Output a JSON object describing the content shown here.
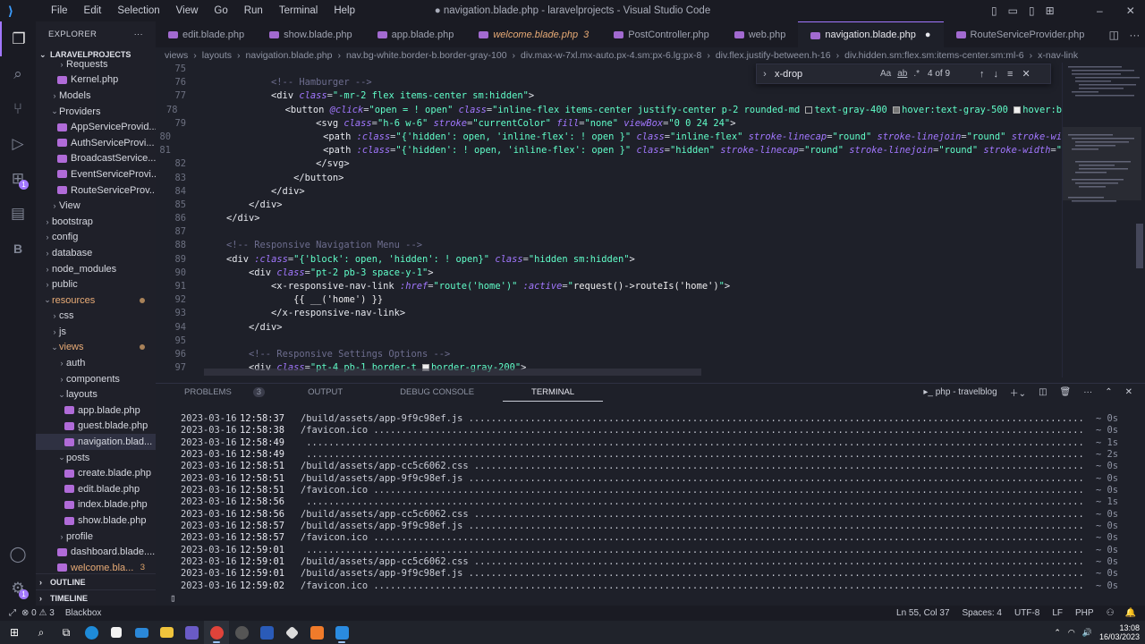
{
  "menubar": [
    "File",
    "Edit",
    "Selection",
    "View",
    "Go",
    "Run",
    "Terminal",
    "Help"
  ],
  "window_title": "● navigation.blade.php - laravelprojects - Visual Studio Code",
  "explorer": {
    "title": "EXPLORER",
    "project": "LARAVELPROJECTS",
    "items": [
      {
        "label": "Requests",
        "depth": 2,
        "type": "folder",
        "open": false
      },
      {
        "label": "Kernel.php",
        "depth": 2,
        "type": "file"
      },
      {
        "label": "Models",
        "depth": 1,
        "type": "folder",
        "open": false
      },
      {
        "label": "Providers",
        "depth": 1,
        "type": "folder",
        "open": true
      },
      {
        "label": "AppServiceProvid...",
        "depth": 2,
        "type": "file"
      },
      {
        "label": "AuthServiceProvi...",
        "depth": 2,
        "type": "file"
      },
      {
        "label": "BroadcastService...",
        "depth": 2,
        "type": "file"
      },
      {
        "label": "EventServiceProvi...",
        "depth": 2,
        "type": "file"
      },
      {
        "label": "RouteServiceProv...",
        "depth": 2,
        "type": "file"
      },
      {
        "label": "View",
        "depth": 1,
        "type": "folder",
        "open": false
      },
      {
        "label": "bootstrap",
        "depth": 0,
        "type": "folder",
        "open": false
      },
      {
        "label": "config",
        "depth": 0,
        "type": "folder",
        "open": false
      },
      {
        "label": "database",
        "depth": 0,
        "type": "folder",
        "open": false
      },
      {
        "label": "node_modules",
        "depth": 0,
        "type": "folder",
        "open": false
      },
      {
        "label": "public",
        "depth": 0,
        "type": "folder",
        "open": false
      },
      {
        "label": "resources",
        "depth": 0,
        "type": "folder",
        "open": true,
        "modified": true
      },
      {
        "label": "css",
        "depth": 1,
        "type": "folder",
        "open": false
      },
      {
        "label": "js",
        "depth": 1,
        "type": "folder",
        "open": false
      },
      {
        "label": "views",
        "depth": 1,
        "type": "folder",
        "open": true,
        "modified": true
      },
      {
        "label": "auth",
        "depth": 2,
        "type": "folder",
        "open": false
      },
      {
        "label": "components",
        "depth": 2,
        "type": "folder",
        "open": false
      },
      {
        "label": "layouts",
        "depth": 2,
        "type": "folder",
        "open": true
      },
      {
        "label": "app.blade.php",
        "depth": 3,
        "type": "file"
      },
      {
        "label": "guest.blade.php",
        "depth": 3,
        "type": "file"
      },
      {
        "label": "navigation.blad...",
        "depth": 3,
        "type": "file",
        "selected": true
      },
      {
        "label": "posts",
        "depth": 2,
        "type": "folder",
        "open": true
      },
      {
        "label": "create.blade.php",
        "depth": 3,
        "type": "file"
      },
      {
        "label": "edit.blade.php",
        "depth": 3,
        "type": "file"
      },
      {
        "label": "index.blade.php",
        "depth": 3,
        "type": "file"
      },
      {
        "label": "show.blade.php",
        "depth": 3,
        "type": "file"
      },
      {
        "label": "profile",
        "depth": 2,
        "type": "folder",
        "open": false
      },
      {
        "label": "dashboard.blade....",
        "depth": 2,
        "type": "file"
      },
      {
        "label": "welcome.bla...",
        "depth": 2,
        "type": "file",
        "count": "3",
        "warn": true
      }
    ],
    "outline": "OUTLINE",
    "timeline": "TIMELINE"
  },
  "tabs": [
    {
      "label": "edit.blade.php"
    },
    {
      "label": "show.blade.php"
    },
    {
      "label": "app.blade.php"
    },
    {
      "label": "welcome.blade.php",
      "count": "3",
      "modified": true
    },
    {
      "label": "PostController.php"
    },
    {
      "label": "web.php"
    },
    {
      "label": "navigation.blade.php",
      "active": true,
      "dirty": "●"
    },
    {
      "label": "RouteServiceProvider.php"
    }
  ],
  "breadcrumb": [
    "views",
    "›",
    "layouts",
    "›",
    "navigation.blade.php",
    "›",
    "nav.bg-white.border-b.border-gray-100",
    "›",
    "div.max-w-7xl.mx-auto.px-4.sm:px-6.lg:px-8",
    "›",
    "div.flex.justify-between.h-16",
    "›",
    "div.hidden.sm:flex.sm:items-center.sm:ml-6",
    "›",
    "x-nav-link"
  ],
  "find": {
    "value": "x-drop",
    "opt_case": "Aa",
    "opt_word": "ab",
    "opt_regex": ".*",
    "result": "4 of 9"
  },
  "code_lines": [
    {
      "n": "75",
      "html": ""
    },
    {
      "n": "76",
      "html": "        <span class='cm'>&lt;!-- Hamburger --&gt;</span>"
    },
    {
      "n": "77",
      "html": "        <span class='tg'>&lt;div</span> <span class='at'>class</span>=<span class='st'>\"-mr-2 flex items-center sm:hidden\"</span><span class='tg'>&gt;</span>"
    },
    {
      "n": "78",
      "html": "            <span class='tg'>&lt;button</span> <span class='at'>@click</span>=<span class='st'>\"open = ! open\"</span> <span class='at'>class</span>=<span class='st'>\"inline-flex items-center justify-center p-2 rounded-md <span class='sw'></span>text-gray-400 <span class='sw' style='background:#777'></span>hover:text-gray-500 <span class='sw' style='background:#eee'></span>hover:b</span>"
    },
    {
      "n": "79",
      "html": "                <span class='tg'>&lt;svg</span> <span class='at'>class</span>=<span class='st'>\"h-6 w-6\"</span> <span class='at'>stroke</span>=<span class='st'>\"currentColor\"</span> <span class='at'>fill</span>=<span class='st'>\"none\"</span> <span class='at'>viewBox</span>=<span class='st'>\"0 0 24 24\"</span><span class='tg'>&gt;</span>"
    },
    {
      "n": "80",
      "html": "                    <span class='tg'>&lt;path</span> <span class='at'>:class</span>=<span class='st'>\"{'hidden': open, 'inline-flex': ! open }\"</span> <span class='at'>class</span>=<span class='st'>\"inline-flex\"</span> <span class='at'>stroke-linecap</span>=<span class='st'>\"round\"</span> <span class='at'>stroke-linejoin</span>=<span class='st'>\"round\"</span> <span class='at'>stroke-wi</span>"
    },
    {
      "n": "81",
      "html": "                    <span class='tg'>&lt;path</span> <span class='at'>:class</span>=<span class='st'>\"{'hidden': ! open, 'inline-flex': open }\"</span> <span class='at'>class</span>=<span class='st'>\"hidden\"</span> <span class='at'>stroke-linecap</span>=<span class='st'>\"round\"</span> <span class='at'>stroke-linejoin</span>=<span class='st'>\"round\"</span> <span class='at'>stroke-width</span>=<span class='st'>\"</span>"
    },
    {
      "n": "82",
      "html": "                <span class='tg'>&lt;/svg&gt;</span>"
    },
    {
      "n": "83",
      "html": "            <span class='tg'>&lt;/button&gt;</span>"
    },
    {
      "n": "84",
      "html": "        <span class='tg'>&lt;/div&gt;</span>"
    },
    {
      "n": "85",
      "html": "    <span class='tg'>&lt;/div&gt;</span>"
    },
    {
      "n": "86",
      "html": "<span class='tg'>&lt;/div&gt;</span>"
    },
    {
      "n": "87",
      "html": ""
    },
    {
      "n": "88",
      "html": "<span class='cm'>&lt;!-- Responsive Navigation Menu --&gt;</span>"
    },
    {
      "n": "89",
      "html": "<span class='tg'>&lt;div</span> <span class='at'>:class</span>=<span class='st'>\"{'block': open, 'hidden': ! open}\"</span> <span class='at'>class</span>=<span class='st'>\"hidden sm:hidden\"</span><span class='tg'>&gt;</span>"
    },
    {
      "n": "90",
      "html": "    <span class='tg'>&lt;div</span> <span class='at'>class</span>=<span class='st'>\"pt-2 pb-3 space-y-1\"</span><span class='tg'>&gt;</span>"
    },
    {
      "n": "91",
      "html": "        <span class='tg'>&lt;x-responsive-nav-link</span> <span class='at'>:href</span>=<span class='st'>\"route('home')\"</span> <span class='at'>:active</span>=<span class='st'>\"</span><span class='tx'>request()-&gt;routeIs('home')</span><span class='st'>\"</span><span class='tg'>&gt;</span>"
    },
    {
      "n": "92",
      "html": "            <span class='tx'>{{ __('home') }}</span>"
    },
    {
      "n": "93",
      "html": "        <span class='tg'>&lt;/x-responsive-nav-link&gt;</span>"
    },
    {
      "n": "94",
      "html": "    <span class='tg'>&lt;/div&gt;</span>"
    },
    {
      "n": "95",
      "html": ""
    },
    {
      "n": "96",
      "html": "    <span class='cm'>&lt;!-- Responsive Settings Options --&gt;</span>"
    },
    {
      "n": "97",
      "html": "    <span class='tg'>&lt;div</span> <span class='at'>class</span>=<span class='st'>\"pt-4 pb-1 border-t <span class='sw' style='background:#eee'></span>border-gray-200\"</span><span class='tg'>&gt;</span>"
    }
  ],
  "panel": {
    "tabs": [
      {
        "label": "PROBLEMS",
        "count": "3"
      },
      {
        "label": "OUTPUT"
      },
      {
        "label": "DEBUG CONSOLE"
      },
      {
        "label": "TERMINAL",
        "active": true
      }
    ],
    "terminal_name": "php - travelblog",
    "log": [
      {
        "date": "2023-03-16",
        "time": "12:58:37",
        "path": "/build/assets/app-9f9c98ef.js",
        "ms": "~ 0s"
      },
      {
        "date": "2023-03-16",
        "time": "12:58:38",
        "path": "/favicon.ico",
        "ms": "~ 0s"
      },
      {
        "date": "2023-03-16",
        "time": "12:58:49",
        "path": "",
        "ms": "~ 1s"
      },
      {
        "date": "2023-03-16",
        "time": "12:58:49",
        "path": "",
        "ms": "~ 2s"
      },
      {
        "date": "2023-03-16",
        "time": "12:58:51",
        "path": "/build/assets/app-cc5c6062.css",
        "ms": "~ 0s"
      },
      {
        "date": "2023-03-16",
        "time": "12:58:51",
        "path": "/build/assets/app-9f9c98ef.js",
        "ms": "~ 0s"
      },
      {
        "date": "2023-03-16",
        "time": "12:58:51",
        "path": "/favicon.ico",
        "ms": "~ 0s"
      },
      {
        "date": "2023-03-16",
        "time": "12:58:56",
        "path": "",
        "ms": "~ 1s"
      },
      {
        "date": "2023-03-16",
        "time": "12:58:56",
        "path": "/build/assets/app-cc5c6062.css",
        "ms": "~ 0s"
      },
      {
        "date": "2023-03-16",
        "time": "12:58:57",
        "path": "/build/assets/app-9f9c98ef.js",
        "ms": "~ 0s"
      },
      {
        "date": "2023-03-16",
        "time": "12:58:57",
        "path": "/favicon.ico",
        "ms": "~ 0s"
      },
      {
        "date": "2023-03-16",
        "time": "12:59:01",
        "path": "",
        "ms": "~ 0s"
      },
      {
        "date": "2023-03-16",
        "time": "12:59:01",
        "path": "/build/assets/app-cc5c6062.css",
        "ms": "~ 0s"
      },
      {
        "date": "2023-03-16",
        "time": "12:59:01",
        "path": "/build/assets/app-9f9c98ef.js",
        "ms": "~ 0s"
      },
      {
        "date": "2023-03-16",
        "time": "12:59:02",
        "path": "/favicon.ico",
        "ms": "~ 0s"
      }
    ]
  },
  "status": {
    "errors": "0",
    "warnings": "3",
    "blackbox": "Blackbox",
    "position": "Ln 55, Col 37",
    "spaces": "Spaces: 4",
    "encoding": "UTF-8",
    "eol": "LF",
    "language": "PHP"
  },
  "taskbar": {
    "time": "13:08",
    "date": "16/03/2023"
  },
  "colors": {
    "accent": "#a277ff",
    "string": "#61ffca",
    "comment": "#6d6d8e"
  }
}
